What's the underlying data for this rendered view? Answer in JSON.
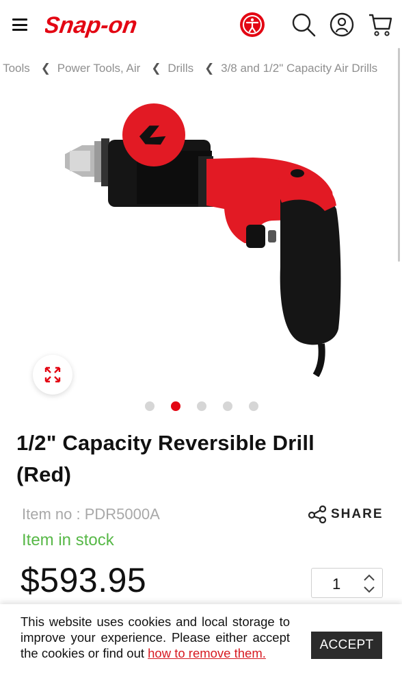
{
  "header": {
    "brand": "Snap-on",
    "icons": [
      "menu-icon",
      "accessibility-icon",
      "search-icon",
      "account-icon",
      "cart-icon"
    ],
    "colors": {
      "brand_red": "#e30613"
    }
  },
  "breadcrumb": {
    "items": [
      "r Tools",
      "Power Tools, Air",
      "Drills",
      "3/8 and 1/2\" Capacity Air Drills"
    ]
  },
  "gallery": {
    "total_images": 5,
    "active_index": 1
  },
  "product": {
    "title": "1/2\" Capacity Reversible Drill (Red)",
    "item_no": "Item no : PDR5000A",
    "stock_status": "Item in stock",
    "price": "$593.95",
    "share_label": "SHARE",
    "quantity": "1",
    "colors": {
      "in_stock": "#57b847",
      "price": "#111111"
    }
  },
  "cookie_banner": {
    "text": "This website uses cookies and local storage to improve your experience. Please either accept the cookies or find out ",
    "link_text": "how to remove them.",
    "accept_label": "ACCEPT"
  }
}
